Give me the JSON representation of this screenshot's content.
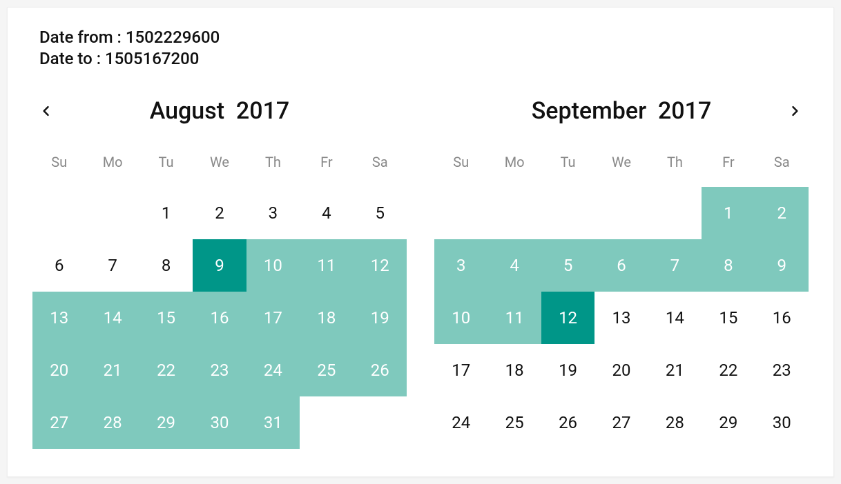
{
  "date_from_label": "Date from : ",
  "date_from_value": "1502229600",
  "date_to_label": "Date to : ",
  "date_to_value": "1505167200",
  "dow": [
    "Su",
    "Mo",
    "Tu",
    "We",
    "Th",
    "Fr",
    "Sa"
  ],
  "colors": {
    "range": "#7fc9bd",
    "endpoint": "#009688"
  },
  "months": [
    {
      "title": "August  2017",
      "has_prev": true,
      "has_next": false,
      "leading_blanks": 2,
      "days": [
        {
          "n": 1,
          "s": ""
        },
        {
          "n": 2,
          "s": ""
        },
        {
          "n": 3,
          "s": ""
        },
        {
          "n": 4,
          "s": ""
        },
        {
          "n": 5,
          "s": ""
        },
        {
          "n": 6,
          "s": ""
        },
        {
          "n": 7,
          "s": ""
        },
        {
          "n": 8,
          "s": ""
        },
        {
          "n": 9,
          "s": "endpoint"
        },
        {
          "n": 10,
          "s": "in-range"
        },
        {
          "n": 11,
          "s": "in-range"
        },
        {
          "n": 12,
          "s": "in-range"
        },
        {
          "n": 13,
          "s": "in-range"
        },
        {
          "n": 14,
          "s": "in-range"
        },
        {
          "n": 15,
          "s": "in-range"
        },
        {
          "n": 16,
          "s": "in-range"
        },
        {
          "n": 17,
          "s": "in-range"
        },
        {
          "n": 18,
          "s": "in-range"
        },
        {
          "n": 19,
          "s": "in-range"
        },
        {
          "n": 20,
          "s": "in-range"
        },
        {
          "n": 21,
          "s": "in-range"
        },
        {
          "n": 22,
          "s": "in-range"
        },
        {
          "n": 23,
          "s": "in-range"
        },
        {
          "n": 24,
          "s": "in-range"
        },
        {
          "n": 25,
          "s": "in-range"
        },
        {
          "n": 26,
          "s": "in-range"
        },
        {
          "n": 27,
          "s": "in-range"
        },
        {
          "n": 28,
          "s": "in-range"
        },
        {
          "n": 29,
          "s": "in-range"
        },
        {
          "n": 30,
          "s": "in-range"
        },
        {
          "n": 31,
          "s": "in-range"
        }
      ]
    },
    {
      "title": "September  2017",
      "has_prev": false,
      "has_next": true,
      "leading_blanks": 5,
      "days": [
        {
          "n": 1,
          "s": "in-range"
        },
        {
          "n": 2,
          "s": "in-range"
        },
        {
          "n": 3,
          "s": "in-range"
        },
        {
          "n": 4,
          "s": "in-range"
        },
        {
          "n": 5,
          "s": "in-range"
        },
        {
          "n": 6,
          "s": "in-range"
        },
        {
          "n": 7,
          "s": "in-range"
        },
        {
          "n": 8,
          "s": "in-range"
        },
        {
          "n": 9,
          "s": "in-range"
        },
        {
          "n": 10,
          "s": "in-range"
        },
        {
          "n": 11,
          "s": "in-range"
        },
        {
          "n": 12,
          "s": "endpoint"
        },
        {
          "n": 13,
          "s": ""
        },
        {
          "n": 14,
          "s": ""
        },
        {
          "n": 15,
          "s": ""
        },
        {
          "n": 16,
          "s": ""
        },
        {
          "n": 17,
          "s": ""
        },
        {
          "n": 18,
          "s": ""
        },
        {
          "n": 19,
          "s": ""
        },
        {
          "n": 20,
          "s": ""
        },
        {
          "n": 21,
          "s": ""
        },
        {
          "n": 22,
          "s": ""
        },
        {
          "n": 23,
          "s": ""
        },
        {
          "n": 24,
          "s": ""
        },
        {
          "n": 25,
          "s": ""
        },
        {
          "n": 26,
          "s": ""
        },
        {
          "n": 27,
          "s": ""
        },
        {
          "n": 28,
          "s": ""
        },
        {
          "n": 29,
          "s": ""
        },
        {
          "n": 30,
          "s": ""
        }
      ]
    }
  ]
}
